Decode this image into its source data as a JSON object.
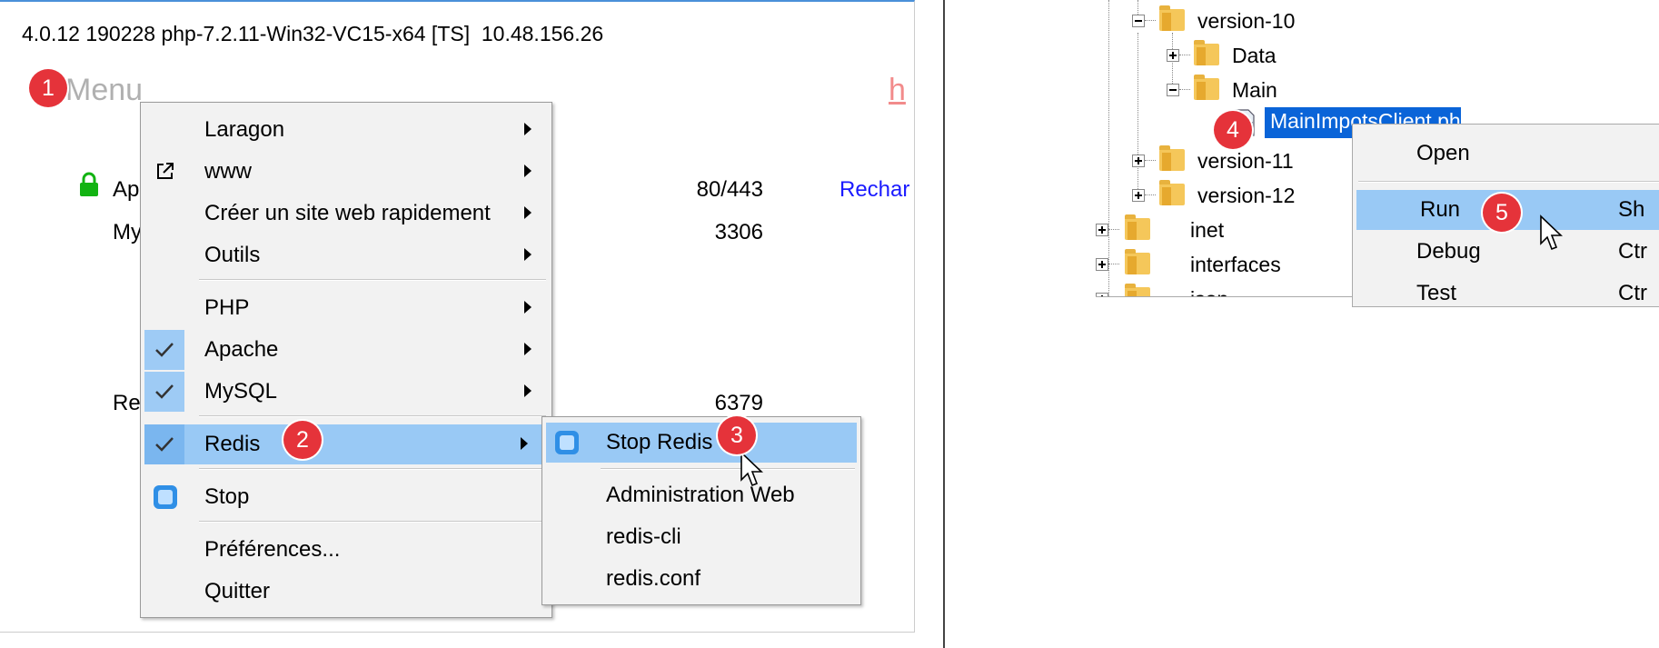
{
  "laragon": {
    "version_line": "4.0.12 190228 php-7.2.11-Win32-VC15-x64 [TS]  10.48.156.26",
    "menu_label": "Menu",
    "h_link": "h",
    "services": [
      {
        "name": "Ap",
        "port": "80/443"
      },
      {
        "name": "My",
        "port": "3306"
      },
      {
        "name": "Re",
        "port": "6379"
      }
    ],
    "reload_label": "Rechar"
  },
  "context_menu": {
    "items": [
      {
        "label": "Laragon",
        "submenu": true
      },
      {
        "label": "www",
        "submenu": true,
        "icon": "external-link-icon"
      },
      {
        "label": "Créer un site web rapidement",
        "submenu": true
      },
      {
        "label": "Outils",
        "submenu": true
      },
      {
        "label": "PHP",
        "submenu": true
      },
      {
        "label": "Apache",
        "submenu": true,
        "checked": true
      },
      {
        "label": "MySQL",
        "submenu": true,
        "checked": true
      },
      {
        "label": "Redis",
        "submenu": true,
        "checked": true,
        "highlighted": true
      },
      {
        "label": "Stop",
        "icon": "stop-icon"
      },
      {
        "label": "Préférences..."
      },
      {
        "label": "Quitter"
      }
    ]
  },
  "redis_submenu": {
    "items": [
      {
        "label": "Stop Redis",
        "icon": "stop-icon",
        "highlighted": true
      },
      {
        "label": "Administration Web"
      },
      {
        "label": "redis-cli"
      },
      {
        "label": "redis.conf"
      }
    ]
  },
  "badges": [
    "1",
    "2",
    "3",
    "4",
    "5"
  ],
  "tree": {
    "nodes": [
      {
        "label": "version-10",
        "expanded": true
      },
      {
        "label": "Data",
        "expanded": false
      },
      {
        "label": "Main",
        "expanded": true
      },
      {
        "label": "MainImpotsClient.php",
        "selected": true,
        "icon": "php-file-icon"
      },
      {
        "label": "version-11",
        "expanded": false
      },
      {
        "label": "version-12",
        "expanded": false
      },
      {
        "label": "inet",
        "expanded": false
      },
      {
        "label": "interfaces",
        "expanded": false
      },
      {
        "label": "json",
        "expanded": false
      }
    ]
  },
  "file_context_menu": {
    "items": [
      {
        "label": "Open",
        "shortcut": ""
      },
      {
        "label": "Run",
        "shortcut": "Sh",
        "highlighted": true
      },
      {
        "label": "Debug",
        "shortcut": "Ctr"
      },
      {
        "label": "Test",
        "shortcut": "Ctr"
      }
    ]
  },
  "colors": {
    "accent_blue": "#2f8fe6",
    "highlight": "#99c9f5",
    "badge_red": "#e5333a",
    "selection": "#0a64d8",
    "link": "#1a1aff"
  }
}
